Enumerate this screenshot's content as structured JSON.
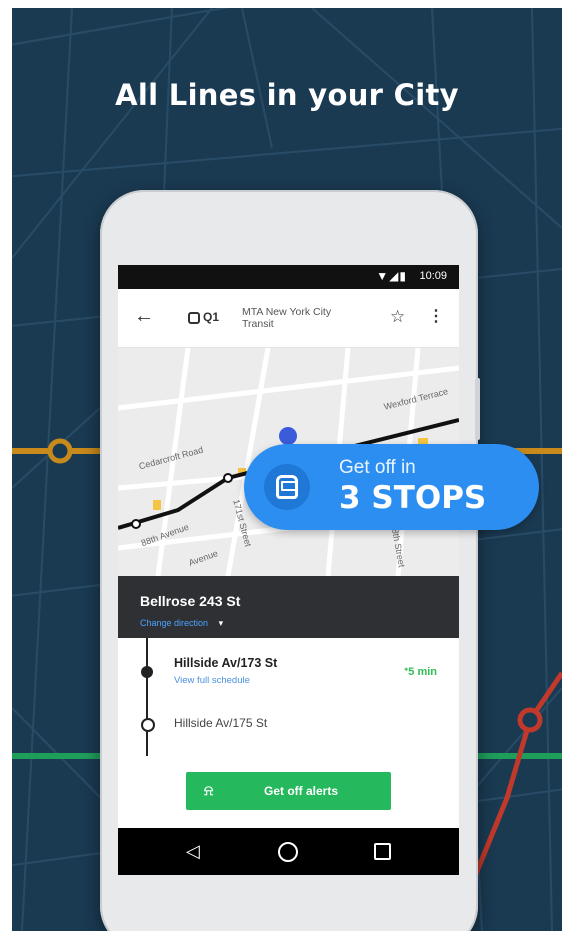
{
  "promo": {
    "headline": "All Lines in your City"
  },
  "status_bar": {
    "time": "10:09",
    "icons": "▼◢▮"
  },
  "app_bar": {
    "back_icon": "←",
    "line": "Q1",
    "agency": "MTA New York City Transit",
    "star_icon": "☆",
    "menu_icon": "⋮"
  },
  "map": {
    "labels": [
      "Cedarcroft Road",
      "Wexford Terrace",
      "88th Avenue",
      "171st Street",
      "178th Street",
      "Avenue"
    ]
  },
  "stop_header": {
    "name": "Bellrose 243 St",
    "change_direction": "Change direction",
    "dropdown_icon": "▾"
  },
  "stops": [
    {
      "name": "Hillside Av/173 St",
      "link": "View full schedule",
      "eta": "5 min"
    },
    {
      "name": "Hillside Av/175 St"
    }
  ],
  "alerts_button": {
    "bell_icon": "⍾",
    "label": "Get off alerts"
  },
  "callout": {
    "line1": "Get off in",
    "line2": "3 STOPS"
  },
  "nav_bar": {
    "back": "◁"
  },
  "colors": {
    "background": "#1a3a52",
    "route_orange": "#c98a1c",
    "route_green": "#1f9e5a",
    "route_red": "#c0392b",
    "callout_blue": "#2b8ef0",
    "button_green": "#25b85c"
  }
}
